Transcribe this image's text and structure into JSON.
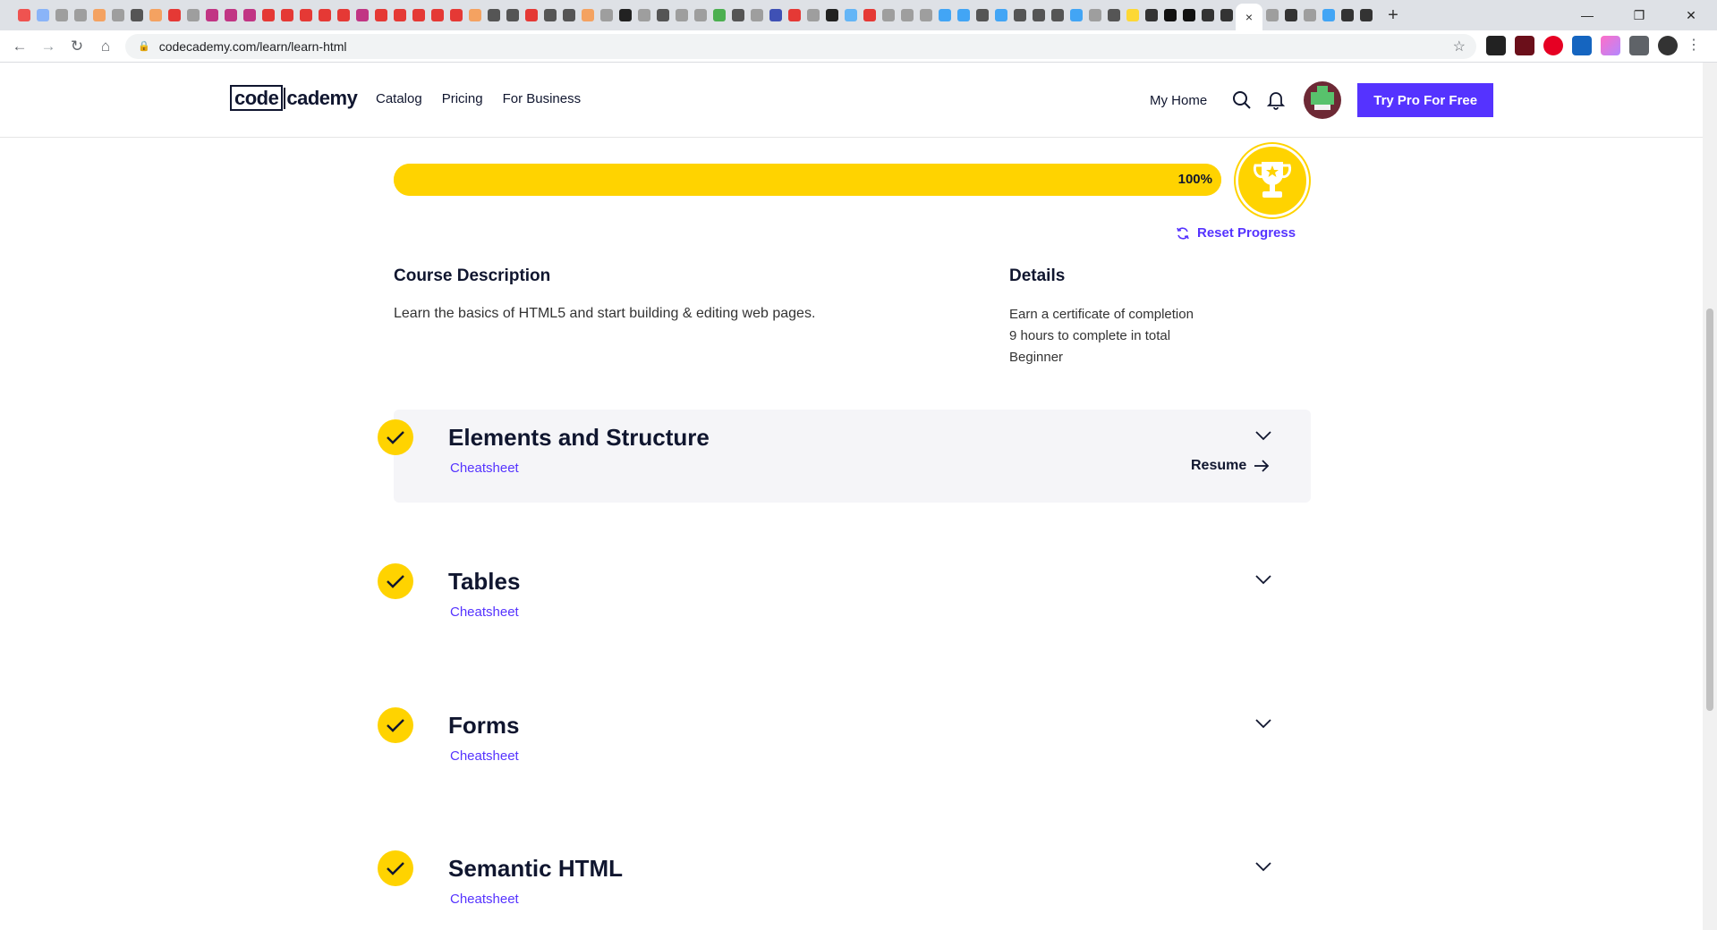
{
  "browser": {
    "active_tab_close": "×",
    "new_tab": "+",
    "url": "codecademy.com/learn/learn-html"
  },
  "header": {
    "logo_code": "code",
    "logo_cademy": "cademy",
    "nav": [
      "Catalog",
      "Pricing",
      "For Business"
    ],
    "my_home": "My Home",
    "cta": "Try Pro For Free"
  },
  "progress": {
    "value": 100,
    "label": "100%",
    "reset_label": "Reset Progress"
  },
  "description": {
    "title": "Course Description",
    "text": "Learn the basics of HTML5 and start building & editing web pages."
  },
  "details": {
    "title": "Details",
    "items": [
      "Earn a certificate of completion",
      "9 hours to complete in total",
      "Beginner"
    ]
  },
  "modules": [
    {
      "title": "Elements and Structure",
      "link": "Cheatsheet",
      "resume": "Resume",
      "completed": true
    },
    {
      "title": "Tables",
      "link": "Cheatsheet",
      "completed": true
    },
    {
      "title": "Forms",
      "link": "Cheatsheet",
      "completed": true
    },
    {
      "title": "Semantic HTML",
      "link": "Cheatsheet",
      "completed": true
    }
  ],
  "colors": {
    "accent": "#5533ff",
    "progress": "#ffd300",
    "text": "#10162f"
  }
}
